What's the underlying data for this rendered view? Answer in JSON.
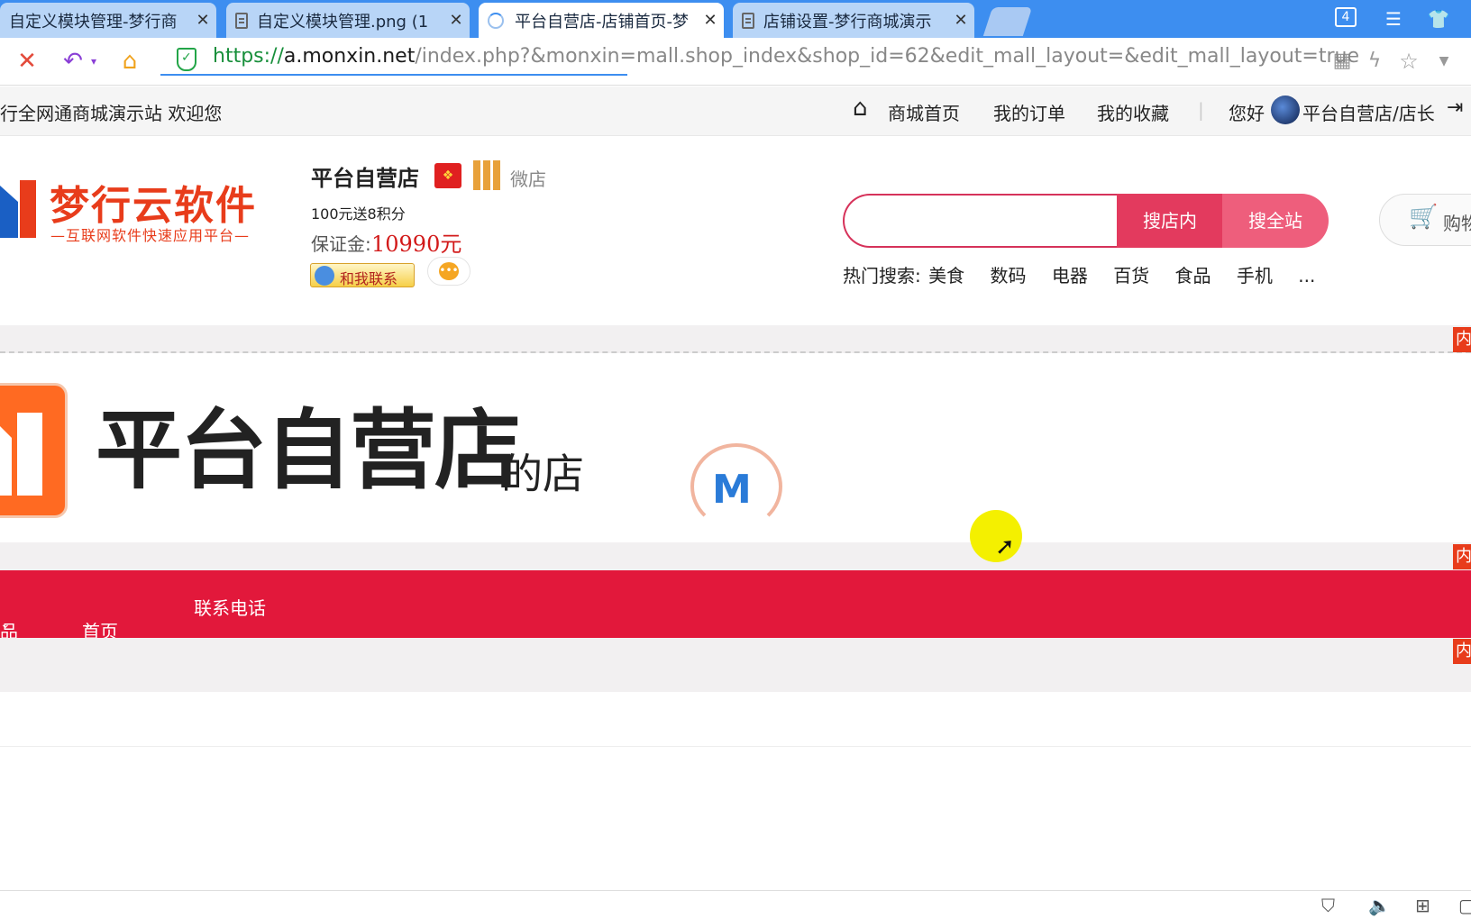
{
  "browser": {
    "tabs": [
      {
        "label": "自定义模块管理-梦行商",
        "close": "✕"
      },
      {
        "label": "自定义模块管理.png (1",
        "close": "✕"
      },
      {
        "label": "平台自营店-店铺首页-梦",
        "close": "✕"
      },
      {
        "label": "店铺设置-梦行商城演示",
        "close": "✕"
      }
    ],
    "tab_count": "4",
    "url_protocol": "https://",
    "url_host": "a.monxin.net",
    "url_path": "/index.php?&monxin=mall.shop_index&shop_id=62&edit_mall_layout=&edit_mall_layout=true"
  },
  "sitebar": {
    "welcome": "行全网通商城演示站 欢迎您",
    "links": [
      "商城首页",
      "我的订单",
      "我的收藏"
    ],
    "divider": "|",
    "greeting": "您好",
    "user": "平台自营店/店长"
  },
  "shop": {
    "brand_name": "梦行云软件",
    "brand_slogan": "—互联网软件快速应用平台—",
    "name": "平台自营店",
    "weidian": "微店",
    "promo": "100元送8积分",
    "deposit_label": "保证金:",
    "deposit_value": "10990元",
    "contact_label": "和我联系"
  },
  "search": {
    "placeholder": "",
    "btn_shop": "搜店内",
    "btn_all": "搜全站",
    "hot_label": "热门搜索:",
    "hot_terms": [
      "美食",
      "数码",
      "电器",
      "百货",
      "食品",
      "手机",
      "..."
    ]
  },
  "cart": {
    "label": "购物"
  },
  "banner": {
    "title": "平台自营店",
    "suffix": "的店"
  },
  "edit_tag": "内",
  "navbar": {
    "items": [
      "品",
      "首页",
      "联系电话"
    ]
  },
  "colors": {
    "accent": "#e2183b",
    "brand_orange": "#e83c1b",
    "tab_bar": "#3d8ef0"
  }
}
